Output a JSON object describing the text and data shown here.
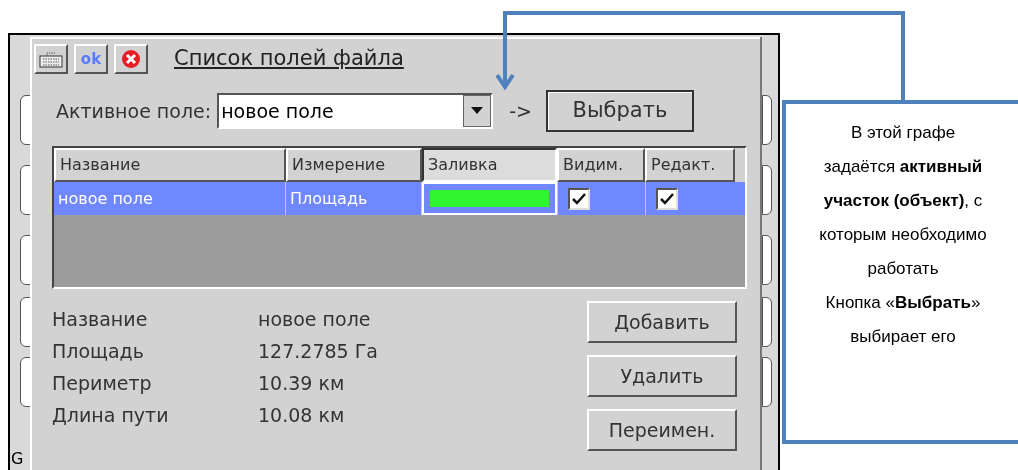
{
  "background_app": {
    "status_text": "G"
  },
  "dialog": {
    "title": "Список полей файла",
    "ok_button": "ok",
    "active_field": {
      "label": "Активное поле:",
      "value": "новое поле",
      "arrow_text": "->",
      "select_button": "Выбрать"
    },
    "table": {
      "columns": [
        {
          "label": "Название",
          "selected": false
        },
        {
          "label": "Измерение",
          "selected": false
        },
        {
          "label": "Заливка",
          "selected": true
        },
        {
          "label": "Видим.",
          "selected": false
        },
        {
          "label": "Редакт.",
          "selected": false
        }
      ],
      "rows": [
        {
          "name": "новое поле",
          "measure": "Площадь",
          "color": "#2ef52e",
          "visible": true,
          "editable": true,
          "selected": true
        }
      ]
    },
    "details": [
      {
        "label": "Название",
        "value": "новое поле"
      },
      {
        "label": "Площадь",
        "value": "127.2785 Га"
      },
      {
        "label": "Периметр",
        "value": "10.39 км"
      },
      {
        "label": "Длина пути",
        "value": "10.08 км"
      }
    ],
    "buttons": [
      "Добавить",
      "Удалить",
      "Переимен."
    ]
  },
  "callout": {
    "paragraphs": [
      "В этой графе задаётся **активный участок (объект)**, с которым необходимо работать",
      "Кнопка «**Выбрать**» выбирает его"
    ]
  }
}
